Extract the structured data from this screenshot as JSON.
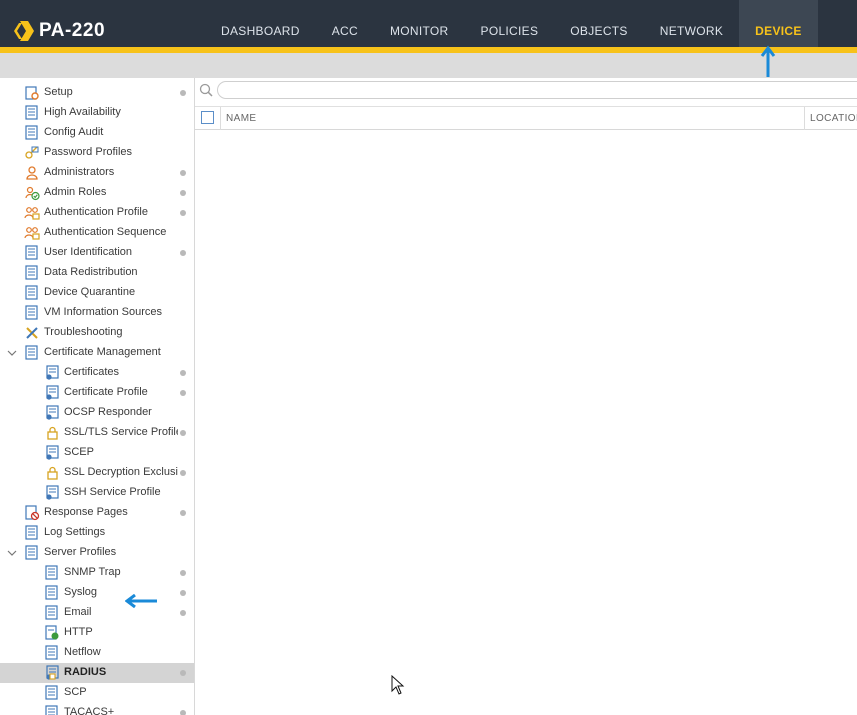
{
  "app": {
    "product": "PA-220",
    "accent_color": "#f7c21a",
    "nav_bg": "#2b3440"
  },
  "nav": {
    "items": [
      {
        "label": "DASHBOARD"
      },
      {
        "label": "ACC"
      },
      {
        "label": "MONITOR"
      },
      {
        "label": "POLICIES"
      },
      {
        "label": "OBJECTS"
      },
      {
        "label": "NETWORK"
      },
      {
        "label": "DEVICE",
        "active": true
      }
    ]
  },
  "sidebar": {
    "items": [
      {
        "label": "Setup",
        "icon": "setup-icon",
        "dot": true
      },
      {
        "label": "High Availability",
        "icon": "ha-icon",
        "dot": false
      },
      {
        "label": "Config Audit",
        "icon": "config-audit-icon",
        "dot": false
      },
      {
        "label": "Password Profiles",
        "icon": "password-icon",
        "dot": false
      },
      {
        "label": "Administrators",
        "icon": "admin-user-icon",
        "dot": true
      },
      {
        "label": "Admin Roles",
        "icon": "admin-role-icon",
        "dot": true
      },
      {
        "label": "Authentication Profile",
        "icon": "auth-profile-icon",
        "dot": true
      },
      {
        "label": "Authentication Sequence",
        "icon": "auth-sequence-icon",
        "dot": false
      },
      {
        "label": "User Identification",
        "icon": "user-id-icon",
        "dot": true
      },
      {
        "label": "Data Redistribution",
        "icon": "redistribution-icon",
        "dot": false
      },
      {
        "label": "Device Quarantine",
        "icon": "quarantine-icon",
        "dot": false
      },
      {
        "label": "VM Information Sources",
        "icon": "vm-icon",
        "dot": false
      },
      {
        "label": "Troubleshooting",
        "icon": "troubleshoot-icon",
        "dot": false
      },
      {
        "label": "Certificate Management",
        "icon": "cert-mgmt-icon",
        "dot": false,
        "expanded": true
      },
      {
        "label": "Certificates",
        "icon": "certificate-icon",
        "dot": true,
        "child": true
      },
      {
        "label": "Certificate Profile",
        "icon": "certificate-profile-icon",
        "dot": true,
        "child": true
      },
      {
        "label": "OCSP Responder",
        "icon": "ocsp-icon",
        "dot": false,
        "child": true
      },
      {
        "label": "SSL/TLS Service Profile",
        "icon": "lock-icon",
        "dot": true,
        "child": true
      },
      {
        "label": "SCEP",
        "icon": "scep-icon",
        "dot": false,
        "child": true
      },
      {
        "label": "SSL Decryption Exclusion",
        "icon": "lock-icon",
        "dot": true,
        "child": true
      },
      {
        "label": "SSH Service Profile",
        "icon": "ssh-icon",
        "dot": false,
        "child": true
      },
      {
        "label": "Response Pages",
        "icon": "response-pages-icon",
        "dot": true
      },
      {
        "label": "Log Settings",
        "icon": "log-settings-icon",
        "dot": false
      },
      {
        "label": "Server Profiles",
        "icon": "server-profiles-icon",
        "dot": false,
        "expanded": true
      },
      {
        "label": "SNMP Trap",
        "icon": "snmp-icon",
        "dot": true,
        "child": true
      },
      {
        "label": "Syslog",
        "icon": "syslog-icon",
        "dot": true,
        "child": true
      },
      {
        "label": "Email",
        "icon": "email-icon",
        "dot": true,
        "child": true
      },
      {
        "label": "HTTP",
        "icon": "http-icon",
        "dot": false,
        "child": true
      },
      {
        "label": "Netflow",
        "icon": "netflow-icon",
        "dot": false,
        "child": true
      },
      {
        "label": "RADIUS",
        "icon": "radius-icon",
        "dot": true,
        "child": true,
        "selected": true
      },
      {
        "label": "SCP",
        "icon": "scp-icon",
        "dot": false,
        "child": true
      },
      {
        "label": "TACACS+",
        "icon": "tacacs-icon",
        "dot": true,
        "child": true
      }
    ]
  },
  "table": {
    "columns": [
      {
        "label": "NAME"
      },
      {
        "label": "LOCATION"
      }
    ]
  }
}
